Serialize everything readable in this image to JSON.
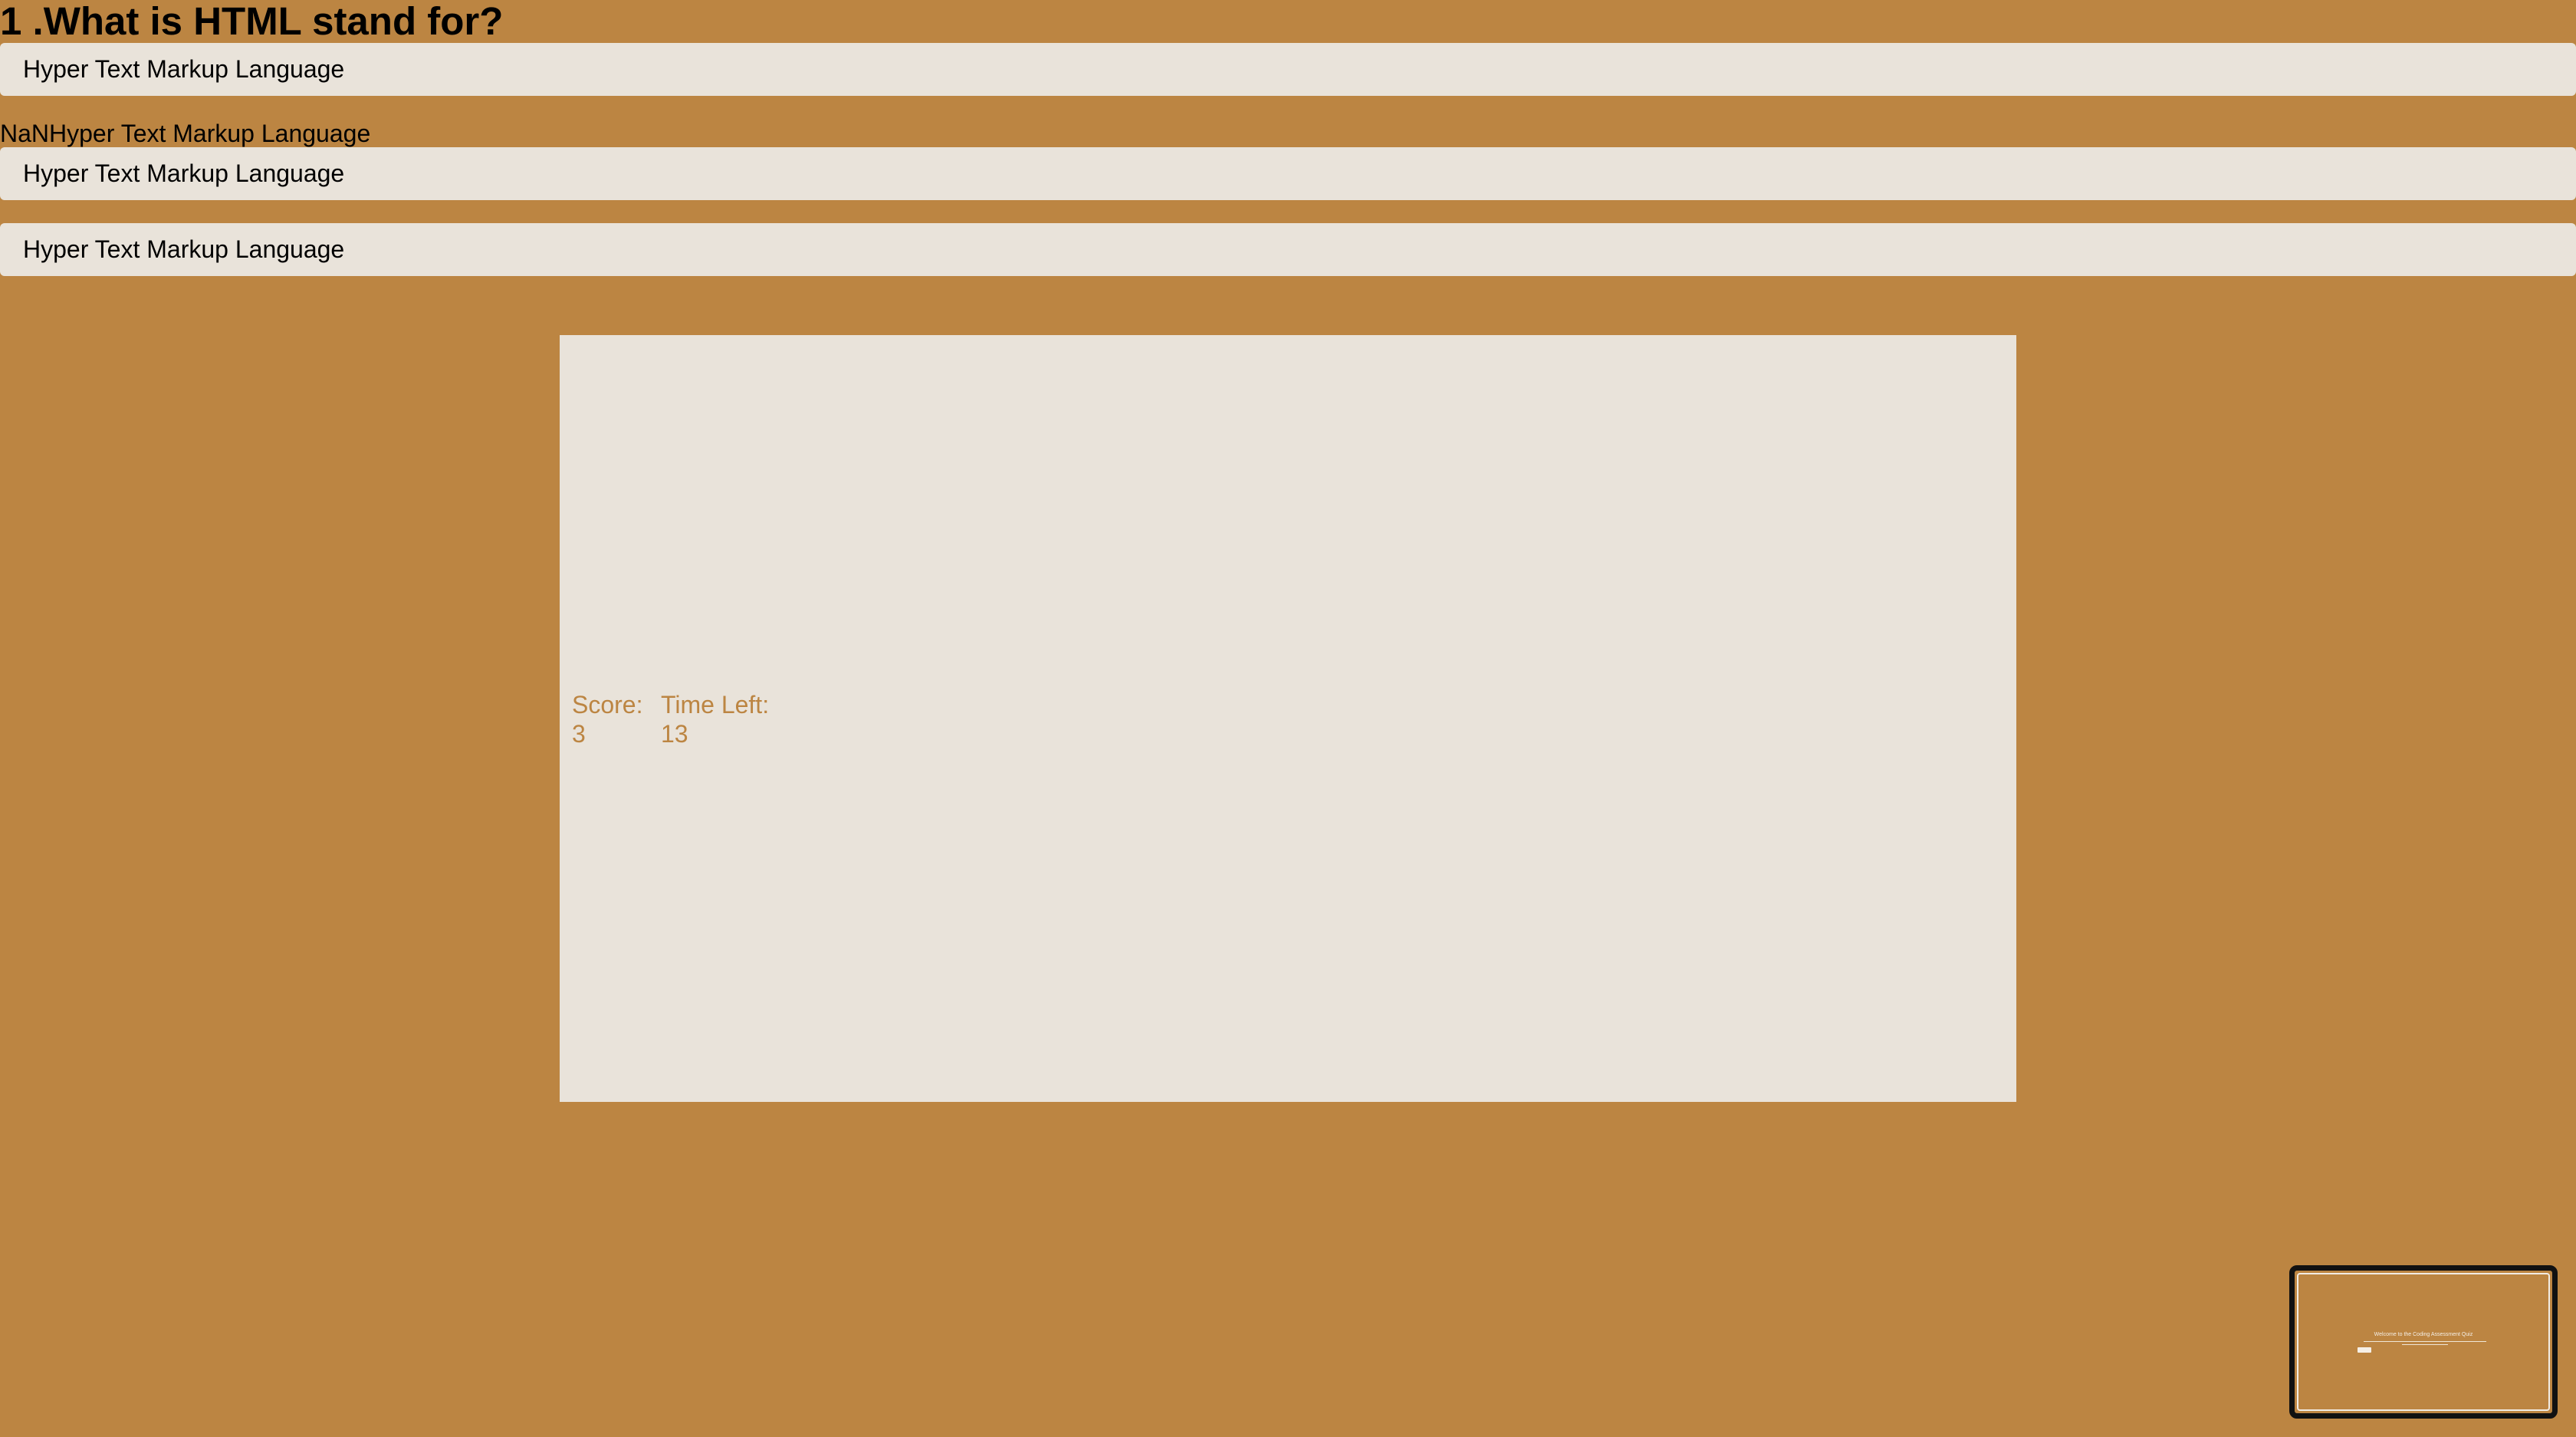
{
  "question": {
    "text": "1 .What is HTML stand for?"
  },
  "answers": [
    {
      "label": "Hyper Text Markup Language"
    },
    {
      "label": "Hyper Text Markup Language"
    },
    {
      "label": "Hyper Text Markup Language"
    }
  ],
  "stray_text": "NaNHyper Text Markup Language",
  "stats": {
    "score_label": "Score:",
    "score_value": "3",
    "time_label": "Time Left:",
    "time_value": "13"
  },
  "thumbnail": {
    "title": "Welcome to the Coding Assessment Quiz"
  },
  "colors": {
    "background": "#bc8542",
    "panel": "#e9e3da",
    "accent_text": "#bc8542"
  }
}
